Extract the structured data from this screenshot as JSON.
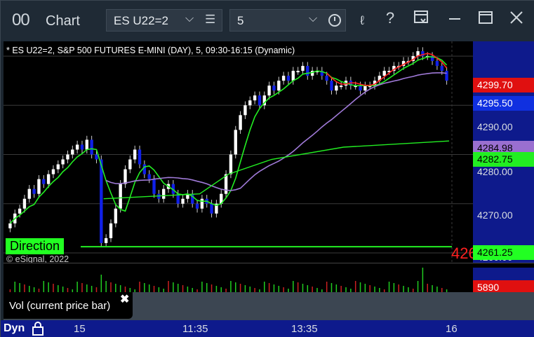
{
  "window": {
    "title_icon": "00",
    "title": "Chart",
    "symbol": "ES U22=2",
    "interval": "5"
  },
  "chart": {
    "header": "* ES U22=2, S&P 500 FUTURES E-MINI (DAY), 5, 09:30-16:15 (Dynamic)",
    "copyright": "© eSignal, 2022",
    "direction_label": "Direction",
    "big_red_text": "426"
  },
  "price_axis": {
    "ticks": [
      "4290.00",
      "4280.00",
      "4270.00"
    ],
    "hidden_tick": "4260.00",
    "labels": [
      {
        "text": "4299.70",
        "bg": "#e01010",
        "fg": "#ffffff"
      },
      {
        "text": "4295.50",
        "bg": "#1030e0",
        "fg": "#ffffff"
      },
      {
        "text": "4284.98",
        "bg": "#9a6fd0",
        "fg": "#000000"
      },
      {
        "text": "4282.75",
        "bg": "#22ee22",
        "fg": "#000000"
      },
      {
        "text": "4261.25",
        "bg": "#22ff22",
        "fg": "#000000"
      }
    ]
  },
  "volume": {
    "value": "5890",
    "study_label": "Vol (current price bar)",
    "close_glyph": "✖"
  },
  "time_axis": {
    "mode": "Dyn",
    "labels": [
      "15",
      "11:35",
      "13:35",
      "16"
    ]
  },
  "colors": {
    "up_candle": "#ffffff",
    "down_candle": "#1020e8",
    "ma_green": "#22ee22",
    "ma_purple": "#a07ad8",
    "ma_red": "#ff2020",
    "axis_bg": "#0e1a8c"
  },
  "chart_data": {
    "type": "candlestick",
    "title": "* ES U22=2, S&P 500 FUTURES E-MINI (DAY), 5, 09:30-16:15 (Dynamic)",
    "ylim": [
      4258,
      4303
    ],
    "series": [
      {
        "name": "close",
        "values": [
          4266,
          4268,
          4269,
          4271,
          4273,
          4272,
          4275,
          4274,
          4276,
          4277,
          4278,
          4279,
          4280,
          4281,
          4282,
          4281,
          4283,
          4280,
          4279,
          4262,
          4263,
          4266,
          4269,
          4274,
          4277,
          4279,
          4281,
          4278,
          4276,
          4275,
          4272,
          4271,
          4273,
          4274,
          4272,
          4270,
          4271,
          4272,
          4270,
          4269,
          4271,
          4270,
          4268,
          4270,
          4272,
          4276,
          4280,
          4285,
          4288,
          4290,
          4291,
          4292,
          4290,
          4292,
          4294,
          4293,
          4295,
          4296,
          4295,
          4297,
          4297,
          4298,
          4296,
          4297,
          4297,
          4296,
          4295,
          4293,
          4294,
          4294,
          4295,
          4294,
          4294,
          4293,
          4294,
          4294,
          4295,
          4296,
          4297,
          4297,
          4298,
          4298,
          4299,
          4299,
          4300,
          4301,
          4300,
          4300,
          4299,
          4298,
          4297,
          4295
        ]
      }
    ]
  }
}
